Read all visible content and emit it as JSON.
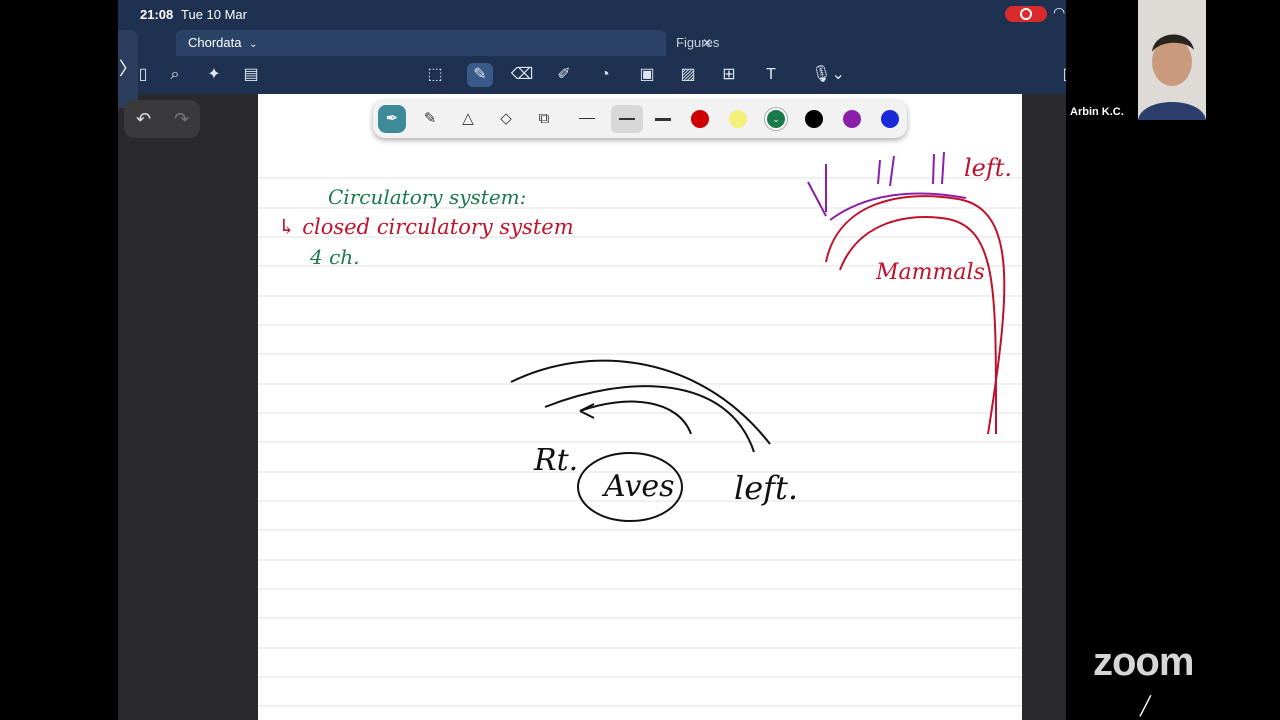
{
  "status": {
    "time": "21:08",
    "date": "Tue 10 Mar"
  },
  "tabs": [
    {
      "label": "Chordata",
      "active": true
    },
    {
      "label": "Figures",
      "active": false
    }
  ],
  "icons": {
    "home": "home-icon",
    "sidebar": "sidebar-icon",
    "search": "search-icon",
    "bookmark": "bookmark-icon",
    "doc": "document-icon",
    "lasso": "lasso-icon",
    "pen": "pen-icon",
    "eraser": "eraser-icon",
    "highlighter": "highlighter-icon",
    "shapes": "shapes-icon",
    "sticky": "sticky-note-icon",
    "image": "image-icon",
    "elements": "elements-icon",
    "text": "text-icon",
    "mic": "microphone-icon",
    "undo": "undo-icon",
    "redo": "redo-icon"
  },
  "pen_colors": [
    "#cc0000",
    "#f5f07a",
    "#1a7a4c",
    "#000000",
    "#8a1fa8",
    "#1a2ad8"
  ],
  "handwriting": {
    "line1": "Circulatory system:",
    "line2": "↳ closed circulatory system",
    "line3": "4 ch.",
    "rt": "Rt.",
    "aves": "Aves",
    "left1": "left.",
    "left2": "left.",
    "mammals": "Mammals"
  },
  "zoom": {
    "participant": "Arbin K.C.",
    "logo": "zoom"
  }
}
